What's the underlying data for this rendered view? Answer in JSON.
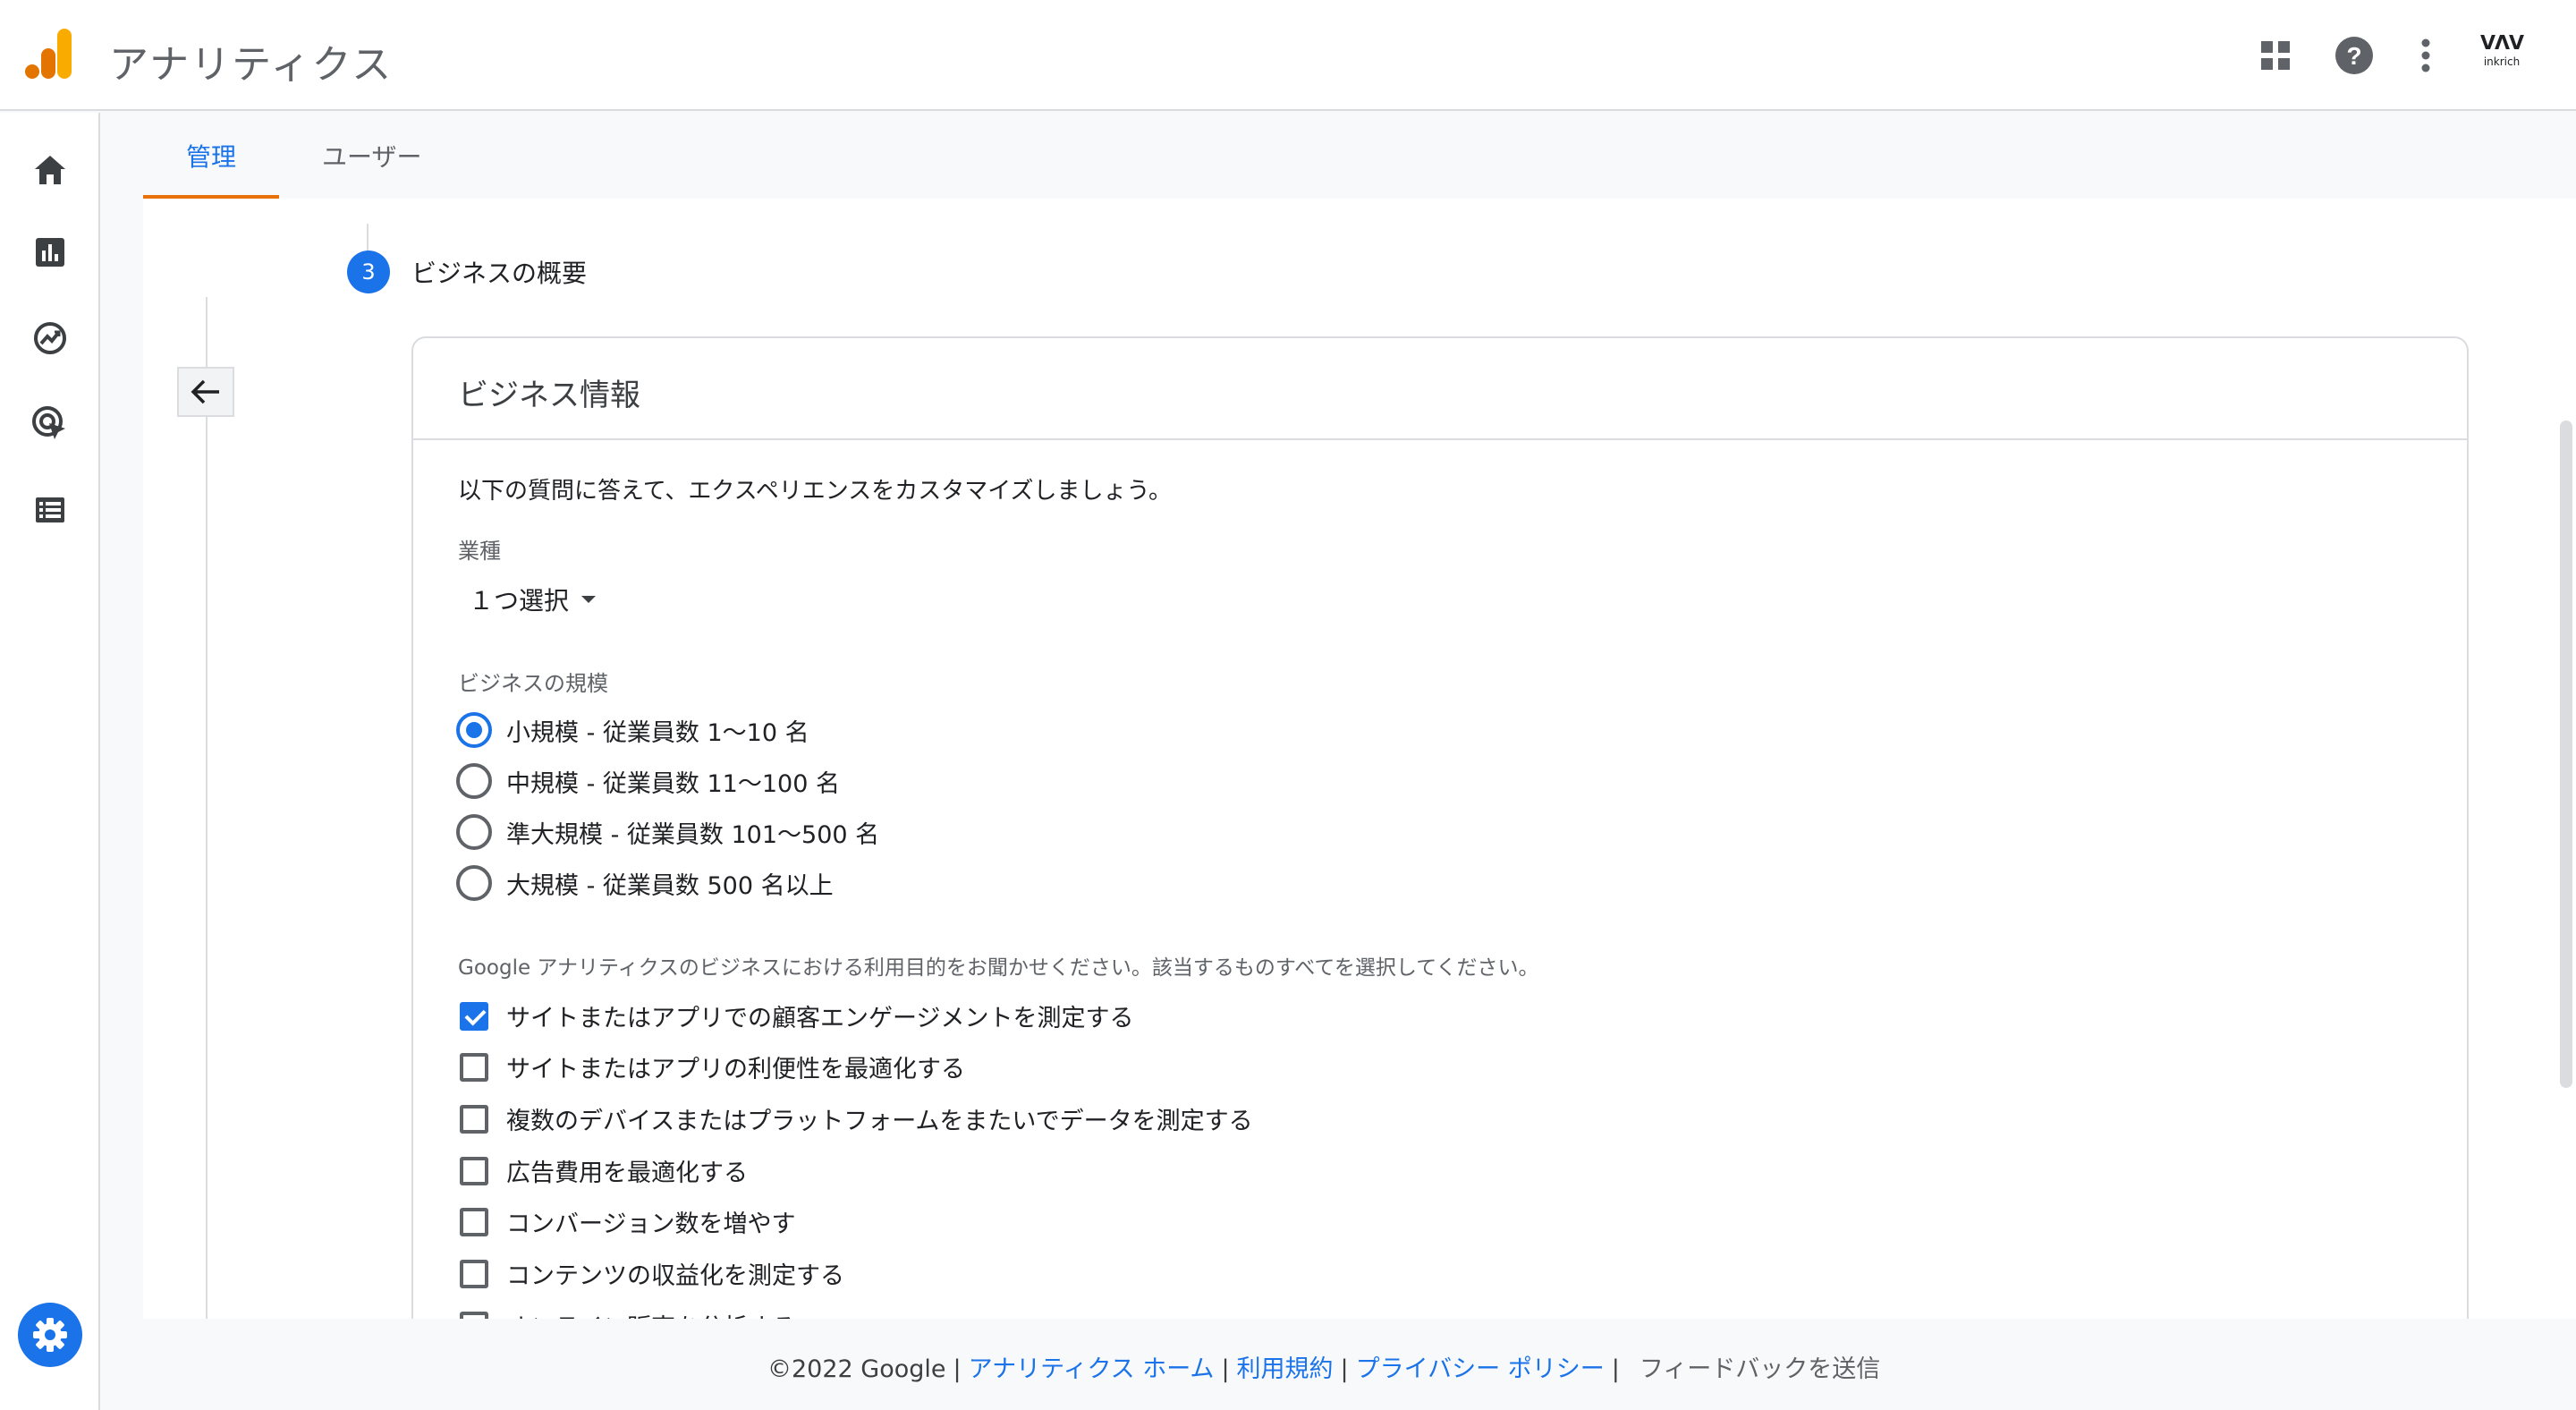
{
  "app": {
    "title": "アナリティクス",
    "brand_mark": "ᐯᐱᐯ",
    "brand_name": "inkrich"
  },
  "colors": {
    "accent": "#1a73e8",
    "tab_underline": "#e8710a",
    "logo_dark": "#e37400",
    "logo_light": "#f9ab00"
  },
  "topbar_icons": [
    "apps-grid-icon",
    "help-icon",
    "more-vert-icon"
  ],
  "sidebar_icons": [
    "home-icon",
    "reports-icon",
    "explore-icon",
    "advertising-icon",
    "configure-icon",
    "settings-icon"
  ],
  "tabs": {
    "admin": "管理",
    "user": "ユーザー"
  },
  "step": {
    "number": "3",
    "label": "ビジネスの概要"
  },
  "card": {
    "title": "ビジネス情報",
    "intro": "以下の質問に答えて、エクスペリエンスをカスタマイズしましょう。",
    "industry_label": "業種",
    "industry_value": "１つ選択",
    "size_label": "ビジネスの規模",
    "size_options": [
      {
        "label": "小規模 - 従業員数 1～10 名",
        "selected": true
      },
      {
        "label": "中規模 - 従業員数 11～100 名",
        "selected": false
      },
      {
        "label": "準大規模 - 従業員数 101～500 名",
        "selected": false
      },
      {
        "label": "大規模 - 従業員数 500 名以上",
        "selected": false
      }
    ],
    "purpose_label": "Google アナリティクスのビジネスにおける利用目的をお聞かせください。該当するものすべてを選択してください。",
    "purpose_options": [
      {
        "label": "サイトまたはアプリでの顧客エンゲージメントを測定する",
        "checked": true
      },
      {
        "label": "サイトまたはアプリの利便性を最適化する",
        "checked": false
      },
      {
        "label": "複数のデバイスまたはプラットフォームをまたいでデータを測定する",
        "checked": false
      },
      {
        "label": "広告費用を最適化する",
        "checked": false
      },
      {
        "label": "コンバージョン数を増やす",
        "checked": false
      },
      {
        "label": "コンテンツの収益化を測定する",
        "checked": false
      },
      {
        "label": "オンライン販売を分析する",
        "checked": false
      }
    ]
  },
  "footer": {
    "copyright": "©2022 Google",
    "links": [
      "アナリティクス ホーム",
      "利用規約",
      "プライバシー ポリシー"
    ],
    "feedback": "フィードバックを送信"
  }
}
